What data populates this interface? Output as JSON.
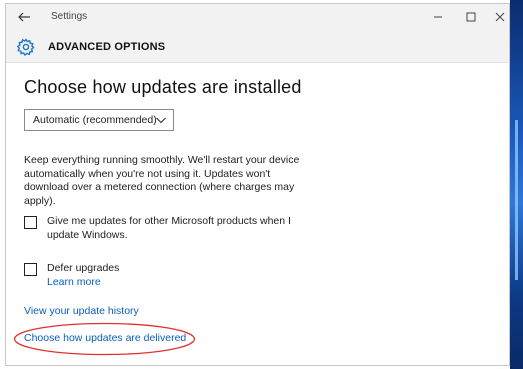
{
  "window": {
    "title": "Settings"
  },
  "header": {
    "title": "ADVANCED OPTIONS",
    "icon": "gear-icon"
  },
  "main": {
    "heading": "Choose how updates are installed",
    "dropdown": {
      "selected": "Automatic (recommended)"
    },
    "description": "Keep everything running smoothly. We'll restart your device automatically when you're not using it. Updates won't download over a metered connection (where charges may apply).",
    "options": [
      {
        "label": "Give me updates for other Microsoft products when I update Windows.",
        "checked": false
      },
      {
        "label": "Defer upgrades",
        "checked": false
      }
    ],
    "learn_more": "Learn more",
    "history_link": "View your update history",
    "delivered_link": "Choose how updates are delivered"
  },
  "colors": {
    "link": "#0a5fc1",
    "accent": "#1f75c9",
    "highlight": "#e03030"
  }
}
